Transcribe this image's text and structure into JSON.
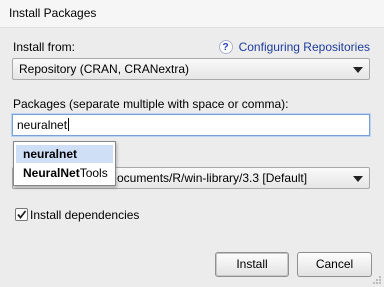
{
  "window": {
    "title": "Install Packages"
  },
  "install_from": {
    "label": "Install from:",
    "selected": "Repository (CRAN, CRANextra)"
  },
  "help": {
    "icon": "help-icon",
    "glyph": "?",
    "link_text": "Configuring Repositories"
  },
  "packages": {
    "label": "Packages (separate multiple with space or comma):",
    "value": "neuralnet"
  },
  "autocomplete": {
    "items": [
      {
        "bold": "neuralnet",
        "rest": ""
      },
      {
        "bold": "NeuralNet",
        "rest": "Tools"
      }
    ],
    "selected_index": 0
  },
  "library": {
    "label_visible": "I",
    "selected_visible": "ocuments/R/win-library/3.3 [Default]"
  },
  "dependencies": {
    "label": "Install dependencies",
    "checked": true
  },
  "buttons": {
    "install": "Install",
    "cancel": "Cancel"
  }
}
